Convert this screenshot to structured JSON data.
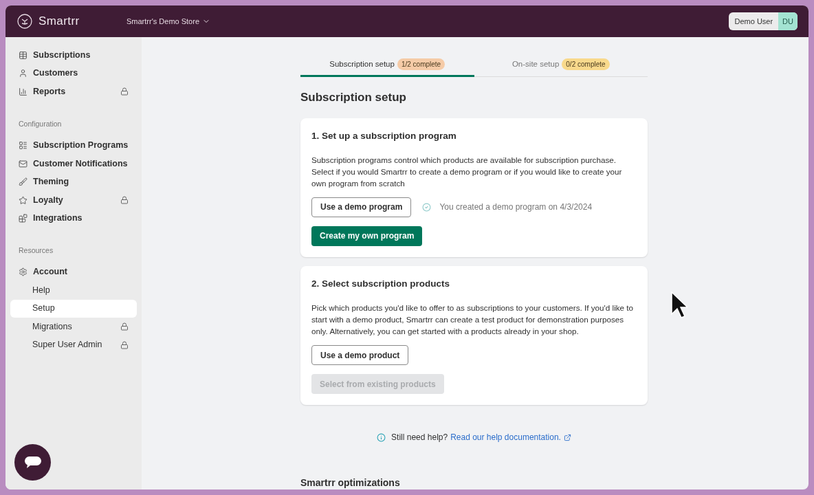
{
  "header": {
    "brand": "Smartrr",
    "store": "Smartrr's Demo Store",
    "user": {
      "name": "Demo User",
      "initials": "DU"
    }
  },
  "sidebar": {
    "sections": [
      {
        "items": [
          {
            "label": "Subscriptions",
            "locked": false,
            "selected": false
          },
          {
            "label": "Customers",
            "locked": false,
            "selected": false
          },
          {
            "label": "Reports",
            "locked": true,
            "selected": false
          }
        ]
      },
      {
        "title": "Configuration",
        "items": [
          {
            "label": "Subscription Programs",
            "locked": false,
            "selected": false
          },
          {
            "label": "Customer Notifications",
            "locked": false,
            "selected": false
          },
          {
            "label": "Theming",
            "locked": false,
            "selected": false
          },
          {
            "label": "Loyalty",
            "locked": true,
            "selected": false
          },
          {
            "label": "Integrations",
            "locked": false,
            "selected": false
          }
        ]
      },
      {
        "title": "Resources",
        "items": [
          {
            "label": "Account",
            "locked": false,
            "selected": false,
            "children": [
              {
                "label": "Help",
                "locked": false,
                "selected": false
              },
              {
                "label": "Setup",
                "locked": false,
                "selected": true
              },
              {
                "label": "Migrations",
                "locked": true,
                "selected": false
              },
              {
                "label": "Super User Admin",
                "locked": true,
                "selected": false
              }
            ]
          }
        ]
      }
    ]
  },
  "tabs": [
    {
      "label": "Subscription setup",
      "badge": "1/2 complete",
      "selected": true,
      "color": "#f5cba7"
    },
    {
      "label": "On-site setup",
      "badge": "0/2 complete",
      "selected": false,
      "color": "#f8d98c"
    }
  ],
  "heading": "Subscription setup",
  "cards": [
    {
      "title": "1. Set up a subscription program",
      "text": "Subscription programs control which products are available for subscription purchase. Select if you would Smartrr to create a demo program or if you would like to create your own program from scratch",
      "buttons": [
        {
          "label": "Use a demo program",
          "kind": "outline",
          "disabled": false,
          "note": "You created a demo program on 4/3/2024"
        },
        {
          "label": "Create my own program",
          "kind": "primary",
          "disabled": false
        }
      ]
    },
    {
      "title": "2. Select subscription products",
      "text": "Pick which products you'd like to offer to as subscriptions to your customers. If you'd like to start with a demo product, Smartrr can create a test product for demonstration purposes only. Alternatively, you can get started with a products already in your shop.",
      "buttons": [
        {
          "label": "Use a demo product",
          "kind": "outline",
          "disabled": false
        },
        {
          "label": "Select from existing products",
          "kind": "primary",
          "disabled": true
        }
      ]
    }
  ],
  "help": {
    "text": "Still need help?",
    "link": "Read our help documentation."
  },
  "next_heading": "Smartrr optimizations"
}
